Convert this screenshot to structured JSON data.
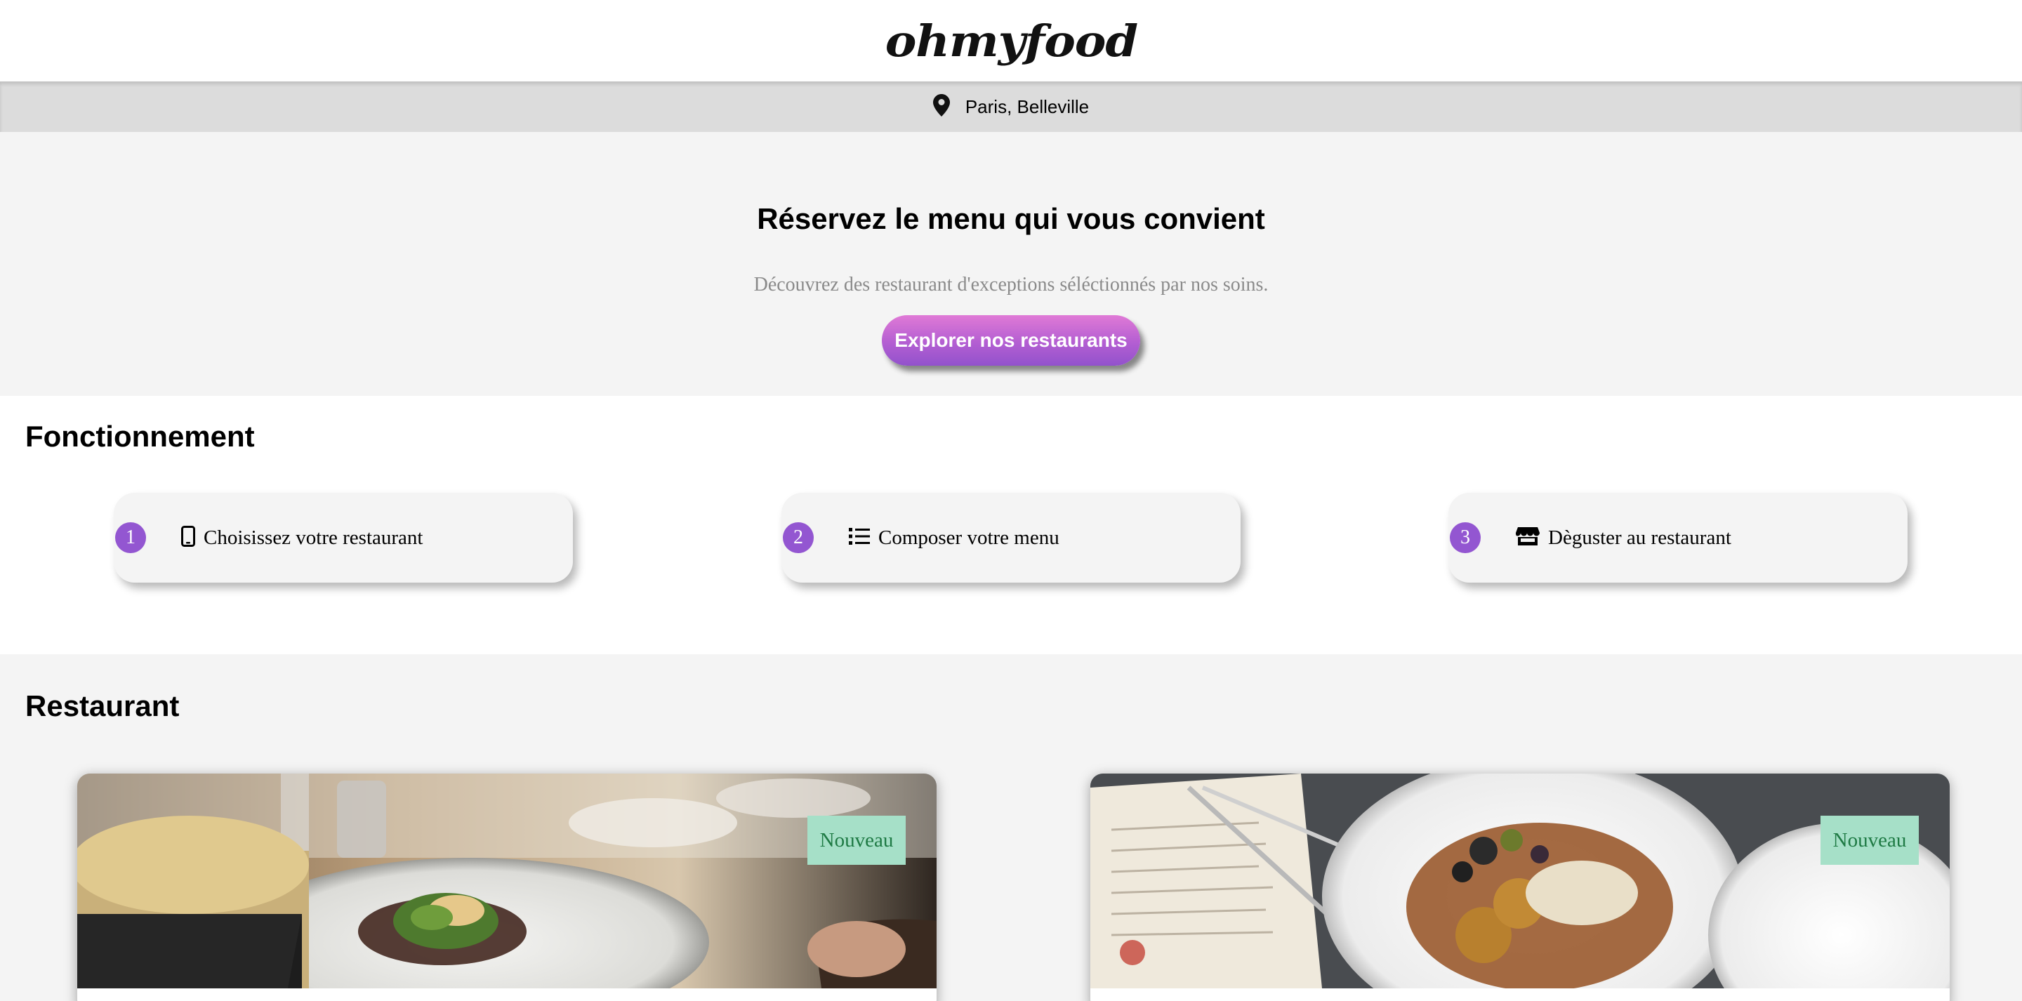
{
  "header": {
    "logo": "ohmyfood"
  },
  "location": {
    "icon": "map-pin-icon",
    "text": "Paris, Belleville"
  },
  "hero": {
    "title": "Réservez le menu qui vous convient",
    "subtitle": "Découvrez des restaurant d'exceptions séléctionnés par nos soins.",
    "cta_label": "Explorer nos restaurants"
  },
  "how": {
    "title": "Fonctionnement",
    "steps": [
      {
        "number": "1",
        "icon": "smartphone-icon",
        "label": "Choisissez votre restaurant"
      },
      {
        "number": "2",
        "icon": "list-icon",
        "label": "Composer votre menu"
      },
      {
        "number": "3",
        "icon": "store-icon",
        "label": "Dèguster au restaurant"
      }
    ]
  },
  "restaurants": {
    "title": "Restaurant",
    "cards": [
      {
        "badge": "Nouveau"
      },
      {
        "badge": "Nouveau"
      }
    ]
  },
  "colors": {
    "accent": "#9356d1",
    "cta_top": "#e07ad6",
    "badge_bg": "#a6e0c8",
    "badge_text": "#1e7a44",
    "section_bg": "#f4f4f4"
  }
}
